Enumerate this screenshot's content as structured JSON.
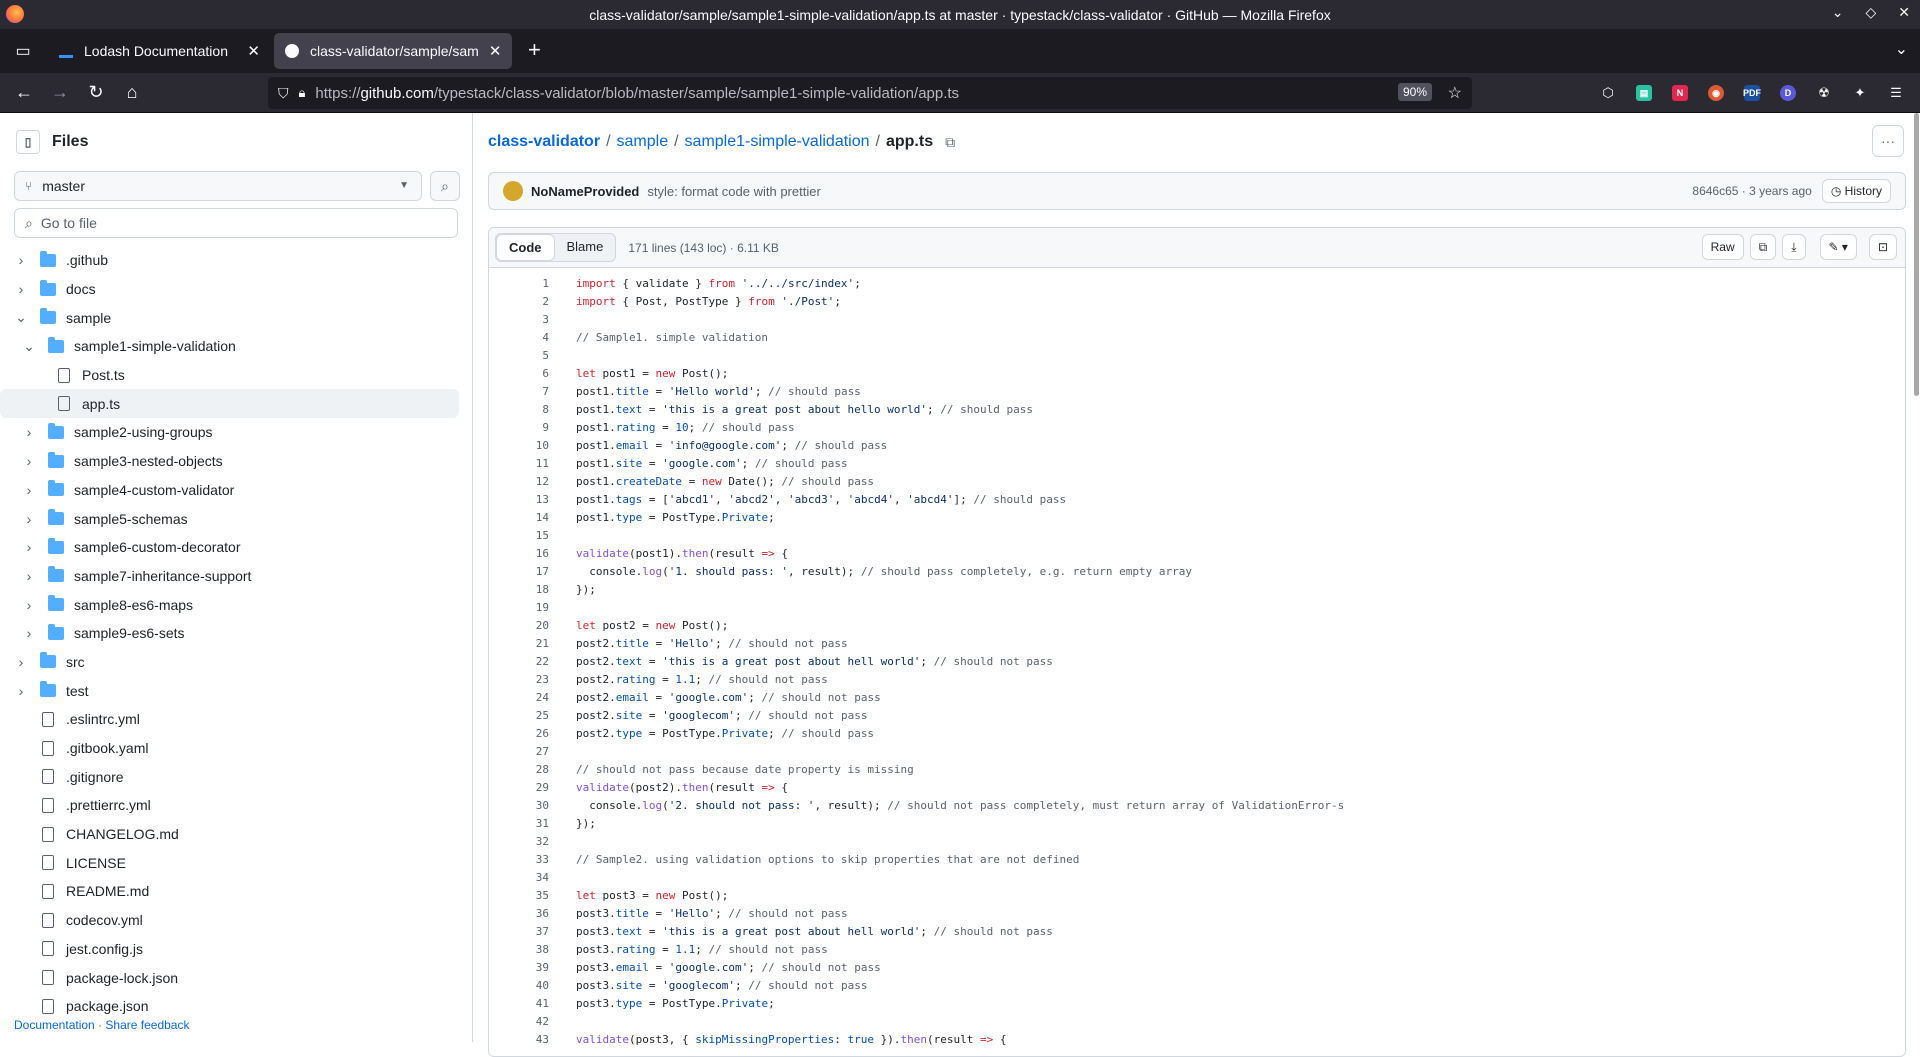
{
  "window": {
    "title": "class-validator/sample/sample1-simple-validation/app.ts at master · typestack/class-validator · GitHub — Mozilla Firefox"
  },
  "tabs": [
    {
      "label": "Lodash Documentation",
      "icon": "lodash-icon"
    },
    {
      "label": "class-validator/sample/sam",
      "icon": "github-icon"
    }
  ],
  "url": {
    "scheme": "https://",
    "host": "github.com",
    "path": "/typestack/class-validator/blob/master/sample/sample1-simple-validation/app.ts",
    "zoom": "90%"
  },
  "sidebar": {
    "title": "Files",
    "branch": "master",
    "goto_placeholder": "Go to file",
    "tree": [
      {
        "label": ".github",
        "type": "folder",
        "level": 0,
        "expanded": false
      },
      {
        "label": "docs",
        "type": "folder",
        "level": 0,
        "expanded": false
      },
      {
        "label": "sample",
        "type": "folder",
        "level": 0,
        "expanded": true
      },
      {
        "label": "sample1-simple-validation",
        "type": "folder",
        "level": 1,
        "expanded": true
      },
      {
        "label": "Post.ts",
        "type": "file",
        "level": 2
      },
      {
        "label": "app.ts",
        "type": "file",
        "level": 2,
        "selected": true
      },
      {
        "label": "sample2-using-groups",
        "type": "folder",
        "level": 1,
        "expanded": false
      },
      {
        "label": "sample3-nested-objects",
        "type": "folder",
        "level": 1,
        "expanded": false
      },
      {
        "label": "sample4-custom-validator",
        "type": "folder",
        "level": 1,
        "expanded": false
      },
      {
        "label": "sample5-schemas",
        "type": "folder",
        "level": 1,
        "expanded": false
      },
      {
        "label": "sample6-custom-decorator",
        "type": "folder",
        "level": 1,
        "expanded": false
      },
      {
        "label": "sample7-inheritance-support",
        "type": "folder",
        "level": 1,
        "expanded": false
      },
      {
        "label": "sample8-es6-maps",
        "type": "folder",
        "level": 1,
        "expanded": false
      },
      {
        "label": "sample9-es6-sets",
        "type": "folder",
        "level": 1,
        "expanded": false
      },
      {
        "label": "src",
        "type": "folder",
        "level": 0,
        "expanded": false
      },
      {
        "label": "test",
        "type": "folder",
        "level": 0,
        "expanded": false
      },
      {
        "label": ".eslintrc.yml",
        "type": "file",
        "level": 0
      },
      {
        "label": ".gitbook.yaml",
        "type": "file",
        "level": 0
      },
      {
        "label": ".gitignore",
        "type": "file",
        "level": 0
      },
      {
        "label": ".prettierrc.yml",
        "type": "file",
        "level": 0
      },
      {
        "label": "CHANGELOG.md",
        "type": "file",
        "level": 0
      },
      {
        "label": "LICENSE",
        "type": "file",
        "level": 0
      },
      {
        "label": "README.md",
        "type": "file",
        "level": 0
      },
      {
        "label": "codecov.yml",
        "type": "file",
        "level": 0
      },
      {
        "label": "jest.config.js",
        "type": "file",
        "level": 0
      },
      {
        "label": "package-lock.json",
        "type": "file",
        "level": 0
      },
      {
        "label": "package.json",
        "type": "file",
        "level": 0
      }
    ],
    "footer_docs": "Documentation",
    "footer_sep": "·",
    "footer_feedback": "Share feedback"
  },
  "breadcrumb": {
    "repo": "class-validator",
    "p1": "sample",
    "p2": "sample1-simple-validation",
    "file": "app.ts"
  },
  "commit": {
    "author": "NoNameProvided",
    "message": "style: format code with prettier",
    "sha": "8646c65",
    "age": "· 3 years ago",
    "history": "History"
  },
  "viewer": {
    "tab_code": "Code",
    "tab_blame": "Blame",
    "info": "171 lines (143 loc) · 6.11 KB",
    "raw": "Raw"
  },
  "code": [
    [
      [
        "k",
        "import"
      ],
      [
        "t",
        " { validate } "
      ],
      [
        "k",
        "from"
      ],
      [
        "s",
        " '../../src/index'"
      ],
      [
        "t",
        ";"
      ]
    ],
    [
      [
        "k",
        "import"
      ],
      [
        "t",
        " { Post, PostType } "
      ],
      [
        "k",
        "from"
      ],
      [
        "s",
        " './Post'"
      ],
      [
        "t",
        ";"
      ]
    ],
    [],
    [
      [
        "c",
        "// Sample1. simple validation"
      ]
    ],
    [],
    [
      [
        "k",
        "let"
      ],
      [
        "t",
        " post1 = "
      ],
      [
        "k",
        "new"
      ],
      [
        "t",
        " Post();"
      ]
    ],
    [
      [
        "t",
        "post1."
      ],
      [
        "p",
        "title"
      ],
      [
        "t",
        " = "
      ],
      [
        "s",
        "'Hello world'"
      ],
      [
        "t",
        "; "
      ],
      [
        "c",
        "// should pass"
      ]
    ],
    [
      [
        "t",
        "post1."
      ],
      [
        "p",
        "text"
      ],
      [
        "t",
        " = "
      ],
      [
        "s",
        "'this is a great post about hello world'"
      ],
      [
        "t",
        "; "
      ],
      [
        "c",
        "// should pass"
      ]
    ],
    [
      [
        "t",
        "post1."
      ],
      [
        "p",
        "rating"
      ],
      [
        "t",
        " = "
      ],
      [
        "p",
        "10"
      ],
      [
        "t",
        "; "
      ],
      [
        "c",
        "// should pass"
      ]
    ],
    [
      [
        "t",
        "post1."
      ],
      [
        "p",
        "email"
      ],
      [
        "t",
        " = "
      ],
      [
        "s",
        "'info@google.com'"
      ],
      [
        "t",
        "; "
      ],
      [
        "c",
        "// should pass"
      ]
    ],
    [
      [
        "t",
        "post1."
      ],
      [
        "p",
        "site"
      ],
      [
        "t",
        " = "
      ],
      [
        "s",
        "'google.com'"
      ],
      [
        "t",
        "; "
      ],
      [
        "c",
        "// should pass"
      ]
    ],
    [
      [
        "t",
        "post1."
      ],
      [
        "p",
        "createDate"
      ],
      [
        "t",
        " = "
      ],
      [
        "k",
        "new"
      ],
      [
        "t",
        " Date(); "
      ],
      [
        "c",
        "// should pass"
      ]
    ],
    [
      [
        "t",
        "post1."
      ],
      [
        "p",
        "tags"
      ],
      [
        "t",
        " = ["
      ],
      [
        "s",
        "'abcd1'"
      ],
      [
        "t",
        ", "
      ],
      [
        "s",
        "'abcd2'"
      ],
      [
        "t",
        ", "
      ],
      [
        "s",
        "'abcd3'"
      ],
      [
        "t",
        ", "
      ],
      [
        "s",
        "'abcd4'"
      ],
      [
        "t",
        ", "
      ],
      [
        "s",
        "'abcd4'"
      ],
      [
        "t",
        "]; "
      ],
      [
        "c",
        "// should pass"
      ]
    ],
    [
      [
        "t",
        "post1."
      ],
      [
        "p",
        "type"
      ],
      [
        "t",
        " = PostType."
      ],
      [
        "p",
        "Private"
      ],
      [
        "t",
        ";"
      ]
    ],
    [],
    [
      [
        "f",
        "validate"
      ],
      [
        "t",
        "(post1)."
      ],
      [
        "f",
        "then"
      ],
      [
        "t",
        "(result "
      ],
      [
        "k",
        "=>"
      ],
      [
        "t",
        " {"
      ]
    ],
    [
      [
        "t",
        "  console."
      ],
      [
        "f",
        "log"
      ],
      [
        "t",
        "("
      ],
      [
        "s",
        "'1. should pass: '"
      ],
      [
        "t",
        ", result); "
      ],
      [
        "c",
        "// should pass completely, e.g. return empty array"
      ]
    ],
    [
      [
        "t",
        "});"
      ]
    ],
    [],
    [
      [
        "k",
        "let"
      ],
      [
        "t",
        " post2 = "
      ],
      [
        "k",
        "new"
      ],
      [
        "t",
        " Post();"
      ]
    ],
    [
      [
        "t",
        "post2."
      ],
      [
        "p",
        "title"
      ],
      [
        "t",
        " = "
      ],
      [
        "s",
        "'Hello'"
      ],
      [
        "t",
        "; "
      ],
      [
        "c",
        "// should not pass"
      ]
    ],
    [
      [
        "t",
        "post2."
      ],
      [
        "p",
        "text"
      ],
      [
        "t",
        " = "
      ],
      [
        "s",
        "'this is a great post about hell world'"
      ],
      [
        "t",
        "; "
      ],
      [
        "c",
        "// should not pass"
      ]
    ],
    [
      [
        "t",
        "post2."
      ],
      [
        "p",
        "rating"
      ],
      [
        "t",
        " = "
      ],
      [
        "p",
        "1.1"
      ],
      [
        "t",
        "; "
      ],
      [
        "c",
        "// should not pass"
      ]
    ],
    [
      [
        "t",
        "post2."
      ],
      [
        "p",
        "email"
      ],
      [
        "t",
        " = "
      ],
      [
        "s",
        "'google.com'"
      ],
      [
        "t",
        "; "
      ],
      [
        "c",
        "// should not pass"
      ]
    ],
    [
      [
        "t",
        "post2."
      ],
      [
        "p",
        "site"
      ],
      [
        "t",
        " = "
      ],
      [
        "s",
        "'googlecom'"
      ],
      [
        "t",
        "; "
      ],
      [
        "c",
        "// should not pass"
      ]
    ],
    [
      [
        "t",
        "post2."
      ],
      [
        "p",
        "type"
      ],
      [
        "t",
        " = PostType."
      ],
      [
        "p",
        "Private"
      ],
      [
        "t",
        "; "
      ],
      [
        "c",
        "// should pass"
      ]
    ],
    [],
    [
      [
        "c",
        "// should not pass because date property is missing"
      ]
    ],
    [
      [
        "f",
        "validate"
      ],
      [
        "t",
        "(post2)."
      ],
      [
        "f",
        "then"
      ],
      [
        "t",
        "(result "
      ],
      [
        "k",
        "=>"
      ],
      [
        "t",
        " {"
      ]
    ],
    [
      [
        "t",
        "  console."
      ],
      [
        "f",
        "log"
      ],
      [
        "t",
        "("
      ],
      [
        "s",
        "'2. should not pass: '"
      ],
      [
        "t",
        ", result); "
      ],
      [
        "c",
        "// should not pass completely, must return array of ValidationError-s"
      ]
    ],
    [
      [
        "t",
        "});"
      ]
    ],
    [],
    [
      [
        "c",
        "// Sample2. using validation options to skip properties that are not defined"
      ]
    ],
    [],
    [
      [
        "k",
        "let"
      ],
      [
        "t",
        " post3 = "
      ],
      [
        "k",
        "new"
      ],
      [
        "t",
        " Post();"
      ]
    ],
    [
      [
        "t",
        "post3."
      ],
      [
        "p",
        "title"
      ],
      [
        "t",
        " = "
      ],
      [
        "s",
        "'Hello'"
      ],
      [
        "t",
        "; "
      ],
      [
        "c",
        "// should not pass"
      ]
    ],
    [
      [
        "t",
        "post3."
      ],
      [
        "p",
        "text"
      ],
      [
        "t",
        " = "
      ],
      [
        "s",
        "'this is a great post about hell world'"
      ],
      [
        "t",
        "; "
      ],
      [
        "c",
        "// should not pass"
      ]
    ],
    [
      [
        "t",
        "post3."
      ],
      [
        "p",
        "rating"
      ],
      [
        "t",
        " = "
      ],
      [
        "p",
        "1.1"
      ],
      [
        "t",
        "; "
      ],
      [
        "c",
        "// should not pass"
      ]
    ],
    [
      [
        "t",
        "post3."
      ],
      [
        "p",
        "email"
      ],
      [
        "t",
        " = "
      ],
      [
        "s",
        "'google.com'"
      ],
      [
        "t",
        "; "
      ],
      [
        "c",
        "// should not pass"
      ]
    ],
    [
      [
        "t",
        "post3."
      ],
      [
        "p",
        "site"
      ],
      [
        "t",
        " = "
      ],
      [
        "s",
        "'googlecom'"
      ],
      [
        "t",
        "; "
      ],
      [
        "c",
        "// should not pass"
      ]
    ],
    [
      [
        "t",
        "post3."
      ],
      [
        "p",
        "type"
      ],
      [
        "t",
        " = PostType."
      ],
      [
        "p",
        "Private"
      ],
      [
        "t",
        ";"
      ]
    ],
    [],
    [
      [
        "f",
        "validate"
      ],
      [
        "t",
        "(post3, { "
      ],
      [
        "p",
        "skipMissingProperties"
      ],
      [
        "t",
        ": "
      ],
      [
        "p",
        "true"
      ],
      [
        "t",
        " })."
      ],
      [
        "f",
        "then"
      ],
      [
        "t",
        "(result "
      ],
      [
        "k",
        "=>"
      ],
      [
        "t",
        " {"
      ]
    ]
  ]
}
